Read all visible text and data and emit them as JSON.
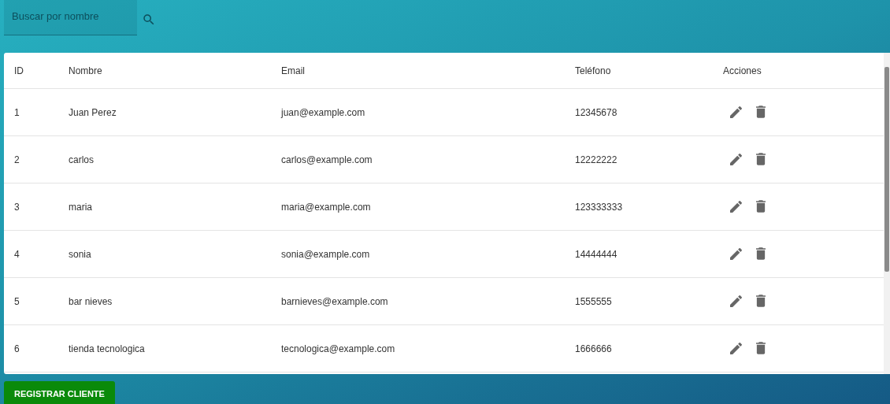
{
  "search": {
    "placeholder": "Buscar por nombre"
  },
  "table": {
    "columns": [
      "ID",
      "Nombre",
      "Email",
      "Teléfono",
      "Acciones"
    ],
    "rows": [
      {
        "id": "1",
        "name": "Juan Perez",
        "email": "juan@example.com",
        "phone": "12345678"
      },
      {
        "id": "2",
        "name": "carlos",
        "email": "carlos@example.com",
        "phone": "12222222"
      },
      {
        "id": "3",
        "name": "maria",
        "email": "maria@example.com",
        "phone": "123333333"
      },
      {
        "id": "4",
        "name": "sonia",
        "email": "sonia@example.com",
        "phone": "14444444"
      },
      {
        "id": "5",
        "name": "bar nieves",
        "email": "barnieves@example.com",
        "phone": "1555555"
      },
      {
        "id": "6",
        "name": "tienda tecnologica",
        "email": "tecnologica@example.com",
        "phone": "1666666"
      }
    ]
  },
  "register_button": {
    "label": "REGISTRAR CLIENTE"
  }
}
